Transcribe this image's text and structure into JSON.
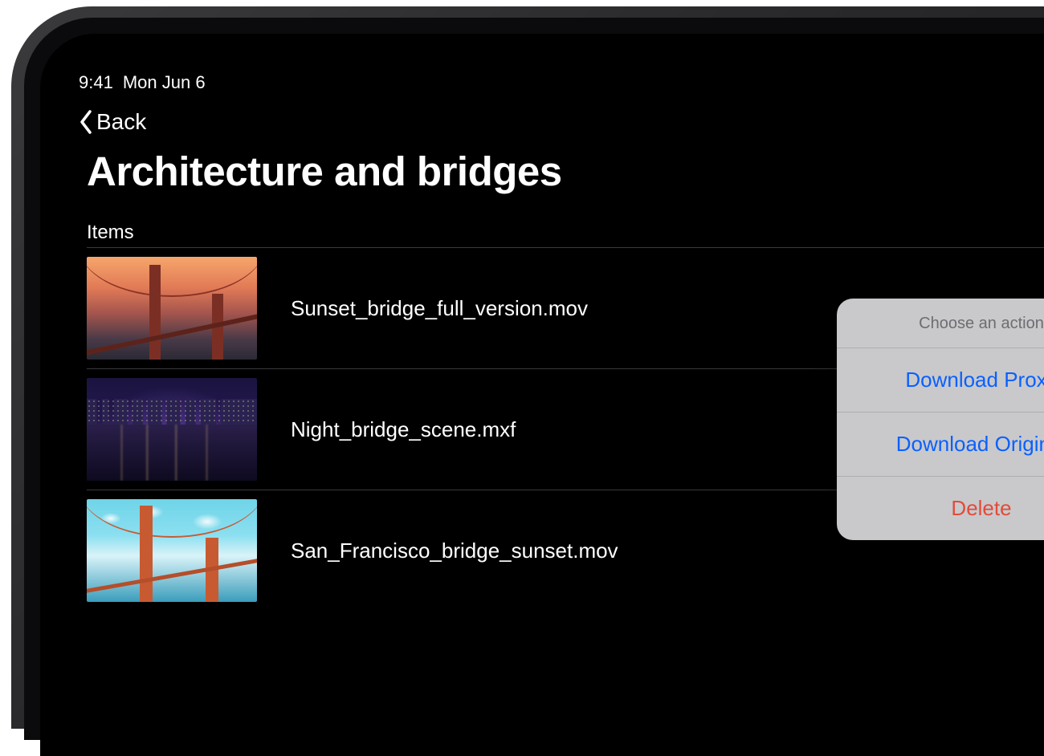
{
  "status_bar": {
    "time": "9:41",
    "date": "Mon Jun 6"
  },
  "nav": {
    "back_label": "Back"
  },
  "page": {
    "title": "Architecture and bridges"
  },
  "items": {
    "section_label": "Items",
    "rows": [
      {
        "filename": "Sunset_bridge_full_version.mov"
      },
      {
        "filename": "Night_bridge_scene.mxf"
      },
      {
        "filename": "San_Francisco_bridge_sunset.mov"
      }
    ]
  },
  "action_popover": {
    "title": "Choose an action",
    "options": {
      "download_proxy": "Download Proxy",
      "download_original": "Download Original",
      "delete": "Delete"
    }
  }
}
